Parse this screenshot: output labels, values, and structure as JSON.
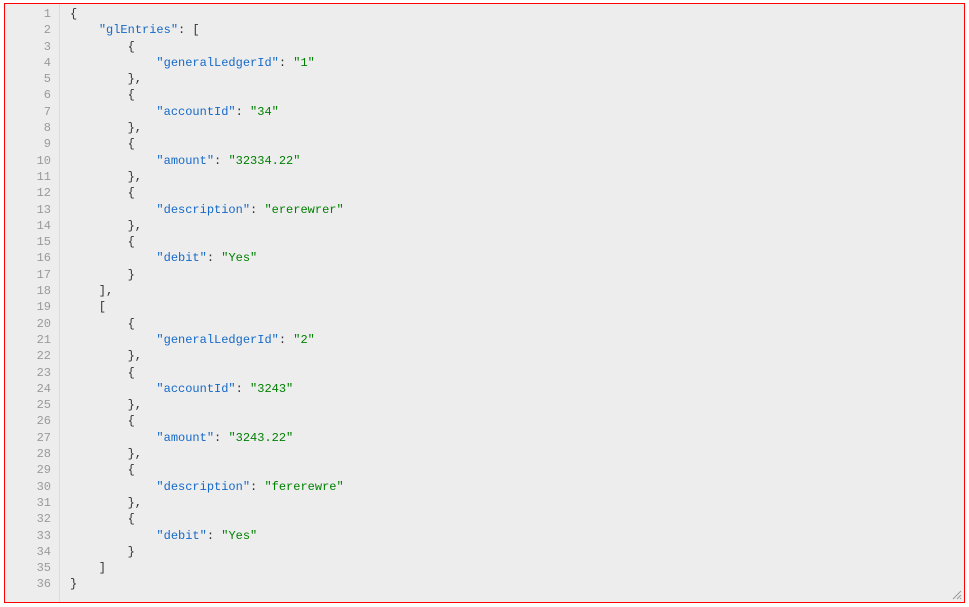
{
  "editor": {
    "lineNumbers": [
      "1",
      "2",
      "3",
      "4",
      "5",
      "6",
      "7",
      "8",
      "9",
      "10",
      "11",
      "12",
      "13",
      "14",
      "15",
      "16",
      "17",
      "18",
      "19",
      "20",
      "21",
      "22",
      "23",
      "24",
      "25",
      "26",
      "27",
      "28",
      "29",
      "30",
      "31",
      "32",
      "33",
      "34",
      "35",
      "36"
    ],
    "lines": [
      [
        {
          "t": "p",
          "x": "{"
        }
      ],
      [
        {
          "t": "p",
          "x": "    "
        },
        {
          "t": "k",
          "x": "\"glEntries\""
        },
        {
          "t": "p",
          "x": ": ["
        }
      ],
      [
        {
          "t": "p",
          "x": "        {"
        }
      ],
      [
        {
          "t": "p",
          "x": "            "
        },
        {
          "t": "k",
          "x": "\"generalLedgerId\""
        },
        {
          "t": "p",
          "x": ": "
        },
        {
          "t": "s",
          "x": "\"1\""
        }
      ],
      [
        {
          "t": "p",
          "x": "        },"
        }
      ],
      [
        {
          "t": "p",
          "x": "        {"
        }
      ],
      [
        {
          "t": "p",
          "x": "            "
        },
        {
          "t": "k",
          "x": "\"accountId\""
        },
        {
          "t": "p",
          "x": ": "
        },
        {
          "t": "s",
          "x": "\"34\""
        }
      ],
      [
        {
          "t": "p",
          "x": "        },"
        }
      ],
      [
        {
          "t": "p",
          "x": "        {"
        }
      ],
      [
        {
          "t": "p",
          "x": "            "
        },
        {
          "t": "k",
          "x": "\"amount\""
        },
        {
          "t": "p",
          "x": ": "
        },
        {
          "t": "s",
          "x": "\"32334.22\""
        }
      ],
      [
        {
          "t": "p",
          "x": "        },"
        }
      ],
      [
        {
          "t": "p",
          "x": "        {"
        }
      ],
      [
        {
          "t": "p",
          "x": "            "
        },
        {
          "t": "k",
          "x": "\"description\""
        },
        {
          "t": "p",
          "x": ": "
        },
        {
          "t": "s",
          "x": "\"ererewrer\""
        }
      ],
      [
        {
          "t": "p",
          "x": "        },"
        }
      ],
      [
        {
          "t": "p",
          "x": "        {"
        }
      ],
      [
        {
          "t": "p",
          "x": "            "
        },
        {
          "t": "k",
          "x": "\"debit\""
        },
        {
          "t": "p",
          "x": ": "
        },
        {
          "t": "s",
          "x": "\"Yes\""
        }
      ],
      [
        {
          "t": "p",
          "x": "        }"
        }
      ],
      [
        {
          "t": "p",
          "x": "    ],"
        }
      ],
      [
        {
          "t": "p",
          "x": "    ["
        }
      ],
      [
        {
          "t": "p",
          "x": "        {"
        }
      ],
      [
        {
          "t": "p",
          "x": "            "
        },
        {
          "t": "k",
          "x": "\"generalLedgerId\""
        },
        {
          "t": "p",
          "x": ": "
        },
        {
          "t": "s",
          "x": "\"2\""
        }
      ],
      [
        {
          "t": "p",
          "x": "        },"
        }
      ],
      [
        {
          "t": "p",
          "x": "        {"
        }
      ],
      [
        {
          "t": "p",
          "x": "            "
        },
        {
          "t": "k",
          "x": "\"accountId\""
        },
        {
          "t": "p",
          "x": ": "
        },
        {
          "t": "s",
          "x": "\"3243\""
        }
      ],
      [
        {
          "t": "p",
          "x": "        },"
        }
      ],
      [
        {
          "t": "p",
          "x": "        {"
        }
      ],
      [
        {
          "t": "p",
          "x": "            "
        },
        {
          "t": "k",
          "x": "\"amount\""
        },
        {
          "t": "p",
          "x": ": "
        },
        {
          "t": "s",
          "x": "\"3243.22\""
        }
      ],
      [
        {
          "t": "p",
          "x": "        },"
        }
      ],
      [
        {
          "t": "p",
          "x": "        {"
        }
      ],
      [
        {
          "t": "p",
          "x": "            "
        },
        {
          "t": "k",
          "x": "\"description\""
        },
        {
          "t": "p",
          "x": ": "
        },
        {
          "t": "s",
          "x": "\"fererewre\""
        }
      ],
      [
        {
          "t": "p",
          "x": "        },"
        }
      ],
      [
        {
          "t": "p",
          "x": "        {"
        }
      ],
      [
        {
          "t": "p",
          "x": "            "
        },
        {
          "t": "k",
          "x": "\"debit\""
        },
        {
          "t": "p",
          "x": ": "
        },
        {
          "t": "s",
          "x": "\"Yes\""
        }
      ],
      [
        {
          "t": "p",
          "x": "        }"
        }
      ],
      [
        {
          "t": "p",
          "x": "    ]"
        }
      ],
      [
        {
          "t": "p",
          "x": "}"
        }
      ]
    ]
  },
  "colors": {
    "border": "#ff0000",
    "background": "#ededed",
    "gutterText": "#9a9a9a",
    "key": "#1569c7",
    "string": "#008000",
    "punct": "#333333"
  }
}
